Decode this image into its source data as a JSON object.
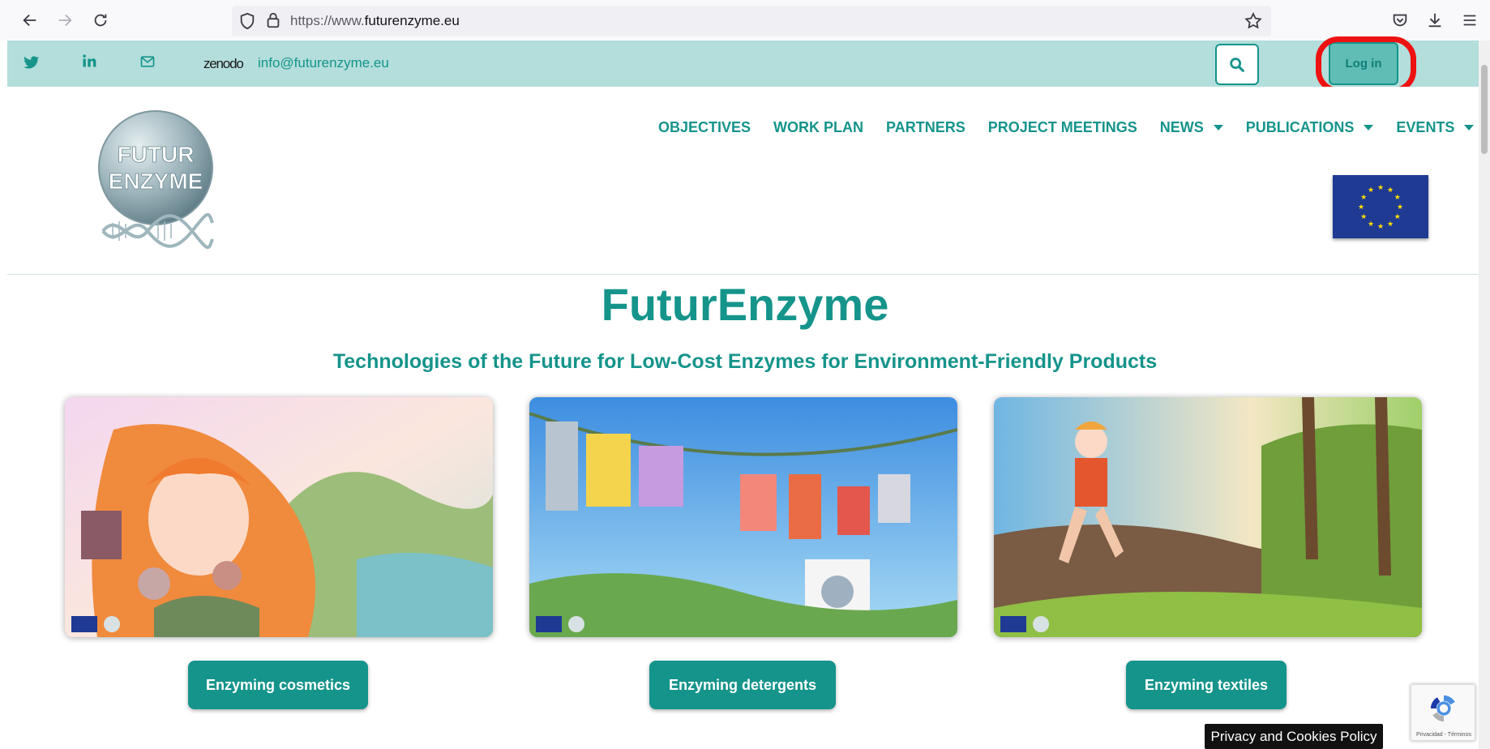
{
  "browser": {
    "url_prefix": "https://www.",
    "url_domain": "futurenzyme.eu",
    "icons": [
      "back-icon",
      "forward-icon",
      "reload-icon",
      "shield-icon",
      "lock-icon",
      "star-icon",
      "pocket-icon",
      "download-icon",
      "menu-icon"
    ]
  },
  "topbar": {
    "icons": [
      "twitter-icon",
      "linkedin-icon",
      "envelope-icon",
      "search-icon"
    ],
    "zenodo": "zenodo",
    "email": "info@futurenzyme.eu",
    "login_label": "Log in"
  },
  "logo": {
    "line1": "FUTUR",
    "line2": "ENZYME"
  },
  "nav": {
    "objectives": "OBJECTIVES",
    "work_plan": "WORK PLAN",
    "partners": "PARTNERS",
    "project_meetings": "PROJECT MEETINGS",
    "news": "NEWS",
    "publications": "PUBLICATIONS",
    "events": "EVENTS"
  },
  "hero": {
    "title": "FuturEnzyme",
    "subtitle": "Technologies of the Future for Low-Cost Enzymes for Environment-Friendly Products"
  },
  "cards": {
    "cosmetics": "Enzyming cosmetics",
    "detergents": "Enzyming detergents",
    "textiles": "Enzyming textiles"
  },
  "recaptcha": {
    "terms": "Privacidad - Términos"
  },
  "footer": {
    "privacy": "Privacy and Cookies Policy"
  },
  "colors": {
    "accent": "#15948b",
    "topbar_bg": "#b3dedb",
    "highlight": "#ee1111",
    "eu_blue": "#1f3a93",
    "eu_star": "#ffdd00"
  }
}
